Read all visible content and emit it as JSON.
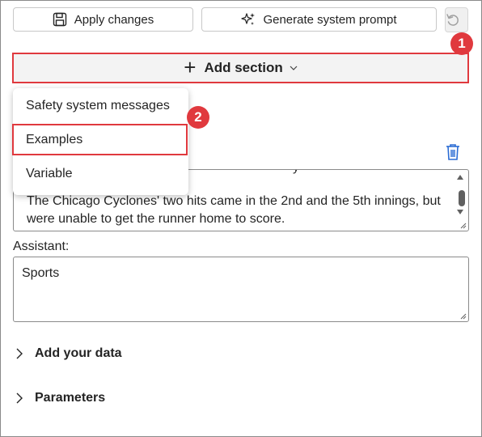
{
  "toolbar": {
    "apply_label": "Apply changes",
    "generate_label": "Generate system prompt",
    "apply_icon": "save-icon",
    "generate_icon": "sparkle-icon",
    "undo_icon": "undo-icon"
  },
  "add_section": {
    "label": "Add section",
    "icon": "plus-icon"
  },
  "callouts": [
    "1",
    "2"
  ],
  "menu": {
    "items": [
      {
        "label": "Safety system messages"
      },
      {
        "label": "Examples"
      },
      {
        "label": "Variable"
      }
    ]
  },
  "example": {
    "user_text_partial": "y",
    "user_text": "The Chicago Cyclones' two hits came in the 2nd and the 5th innings, but were unable to get the runner home to score.",
    "assistant_label": "Assistant:",
    "assistant_value": "Sports"
  },
  "sections": [
    {
      "label": "Add your data"
    },
    {
      "label": "Parameters"
    }
  ],
  "colors": {
    "accent_red": "#e0393e",
    "trash_blue": "#2b6cd4"
  }
}
